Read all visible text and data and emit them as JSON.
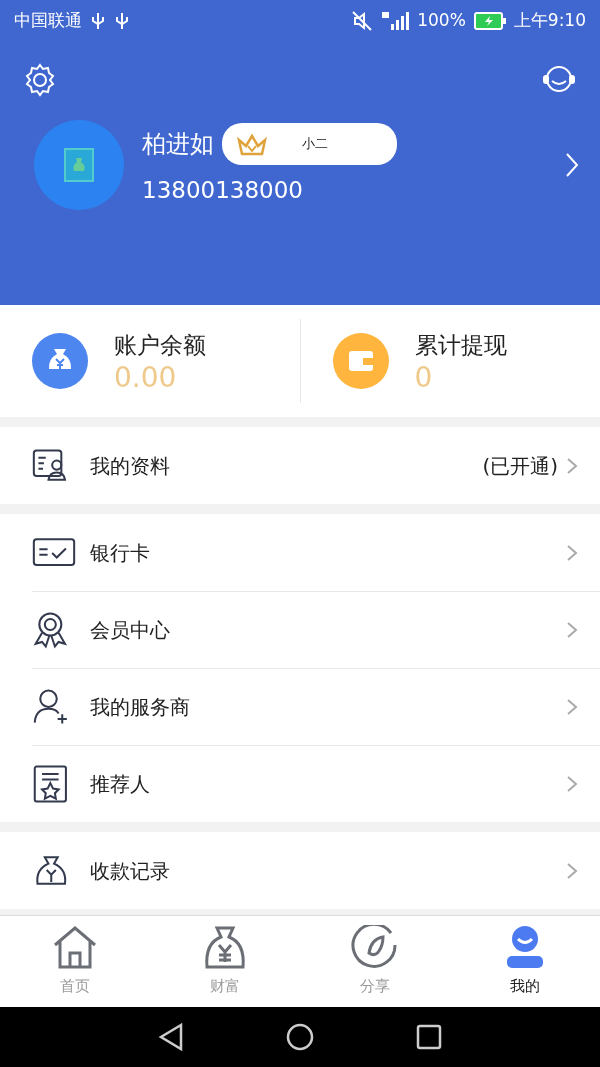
{
  "status_bar": {
    "carrier": "中国联通",
    "battery": "100%",
    "time": "上午9:10"
  },
  "profile": {
    "name": "柏进如",
    "level_badge": "小二",
    "phone": "13800138000"
  },
  "stats": [
    {
      "kind": "balance",
      "label": "账户余额",
      "value": "0.00"
    },
    {
      "kind": "withdraw",
      "label": "累计提现",
      "value": "0"
    }
  ],
  "menu_groups": [
    [
      {
        "kind": "profile",
        "label": "我的资料",
        "status": "(已开通)"
      }
    ],
    [
      {
        "kind": "card",
        "label": "银行卡"
      },
      {
        "kind": "medal",
        "label": "会员中心"
      },
      {
        "kind": "person-add",
        "label": "我的服务商"
      },
      {
        "kind": "star-doc",
        "label": "推荐人"
      }
    ],
    [
      {
        "kind": "bag",
        "label": "收款记录"
      }
    ]
  ],
  "tabs": [
    {
      "kind": "home",
      "label": "首页",
      "selected": false
    },
    {
      "kind": "wealth",
      "label": "财富",
      "selected": false
    },
    {
      "kind": "share",
      "label": "分享",
      "selected": false
    },
    {
      "kind": "me",
      "label": "我的",
      "selected": true
    }
  ]
}
